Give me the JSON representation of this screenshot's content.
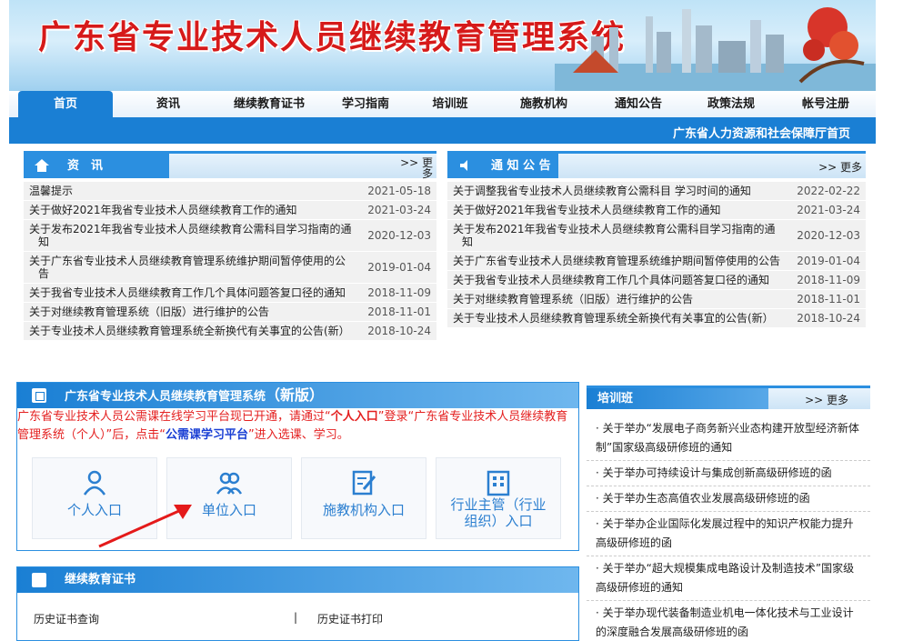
{
  "banner": {
    "title": "广东省专业技术人员继续教育管理系统"
  },
  "nav": {
    "items": [
      "首页",
      "资讯",
      "继续教育证书",
      "学习指南",
      "培训班",
      "施教机构",
      "通知公告",
      "政策法规",
      "帐号注册"
    ],
    "active_index": 0,
    "hrss_link": "广东省人力资源和社会保障厅首页"
  },
  "news": {
    "title": "资　讯",
    "more": ">> 更多",
    "rows": [
      {
        "title": "温馨提示",
        "date": "2021-05-18"
      },
      {
        "title": "关于做好2021年我省专业技术人员继续教育工作的通知",
        "date": "2021-03-24"
      },
      {
        "title": "关于发布2021年我省专业技术人员继续教育公需科目学习指南的通知",
        "date": "2020-12-03"
      },
      {
        "title": "关于广东省专业技术人员继续教育管理系统维护期间暂停使用的公告",
        "date": "2019-01-04"
      },
      {
        "title": "关于我省专业技术人员继续教育工作几个具体问题答复口径的通知",
        "date": "2018-11-09"
      },
      {
        "title": "关于对继续教育管理系统（旧版）进行维护的公告",
        "date": "2018-11-01"
      },
      {
        "title": "关于专业技术人员继续教育管理系统全新换代有关事宜的公告(新）",
        "date": "2018-10-24"
      }
    ]
  },
  "notices": {
    "title": "通 知 公 告",
    "more": ">> 更多",
    "rows": [
      {
        "title": "关于调整我省专业技术人员继续教育公需科目 学习时间的通知",
        "date": "2022-02-22"
      },
      {
        "title": "关于做好2021年我省专业技术人员继续教育工作的通知",
        "date": "2021-03-24"
      },
      {
        "title": "关于发布2021年我省专业技术人员继续教育公需科目学习指南的通知",
        "date": "2020-12-03"
      },
      {
        "title": "关于广东省专业技术人员继续教育管理系统维护期间暂停使用的公告",
        "date": "2019-01-04"
      },
      {
        "title": "关于我省专业技术人员继续教育工作几个具体问题答复口径的通知",
        "date": "2018-11-09"
      },
      {
        "title": "关于对继续教育管理系统（旧版）进行维护的公告",
        "date": "2018-11-01"
      },
      {
        "title": "关于专业技术人员继续教育管理系统全新换代有关事宜的公告(新）",
        "date": "2018-10-24"
      }
    ]
  },
  "system": {
    "title": "广东省专业技术人员继续教育管理系统",
    "title_suffix": "（新版）",
    "desc_1": "广东省专业技术人员公需课在线学习平台现已开通，请通过“",
    "desc_personal": "个人入口",
    "desc_2": "”登录“广东省专业技术人员继续教育管理系统（个人）”后，点击“",
    "desc_platform": "公需课学习平台",
    "desc_3": "”进入选课、学习。",
    "entries": [
      "个人入口",
      "单位入口",
      "施教机构入口",
      "行业主管（行业组织）入口"
    ]
  },
  "cert": {
    "title": "继续教育证书",
    "query": "历史证书查询",
    "separator": "|",
    "print": "历史证书打印"
  },
  "training": {
    "title": "培训班",
    "more": ">> 更多",
    "items": [
      "· 关于举办“发展电子商务新兴业态构建开放型经济新体制”国家级高级研修班的通知",
      "· 关于举办可持续设计与集成创新高级研修班的函",
      "· 关于举办生态高值农业发展高级研修班的函",
      "· 关于举办企业国际化发展过程中的知识产权能力提升高级研修班的函",
      "· 关于举办“超大规模集成电路设计及制造技术”国家级高级研修班的通知",
      "· 关于举办现代装备制造业机电一体化技术与工业设计的深度融合发展高级研修班的函"
    ]
  }
}
